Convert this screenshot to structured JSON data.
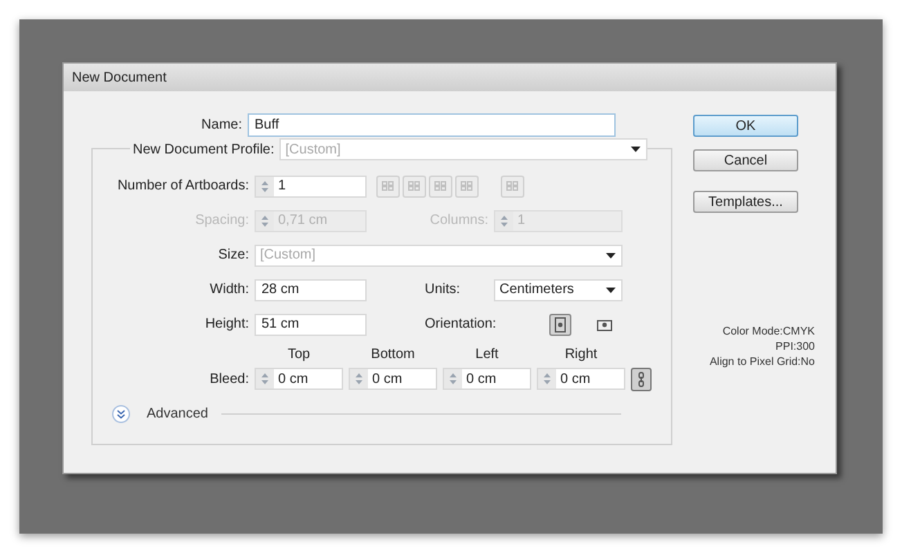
{
  "window": {
    "title": "New Document"
  },
  "name": {
    "label": "Name:",
    "value": "Buff"
  },
  "profile": {
    "label": "New Document Profile:",
    "placeholder": "[Custom]"
  },
  "artboards": {
    "label": "Number of Artboards:",
    "value": "1"
  },
  "spacing": {
    "label": "Spacing:",
    "value": "0,71 cm",
    "disabled": true
  },
  "columns": {
    "label": "Columns:",
    "value": "1",
    "disabled": true
  },
  "size": {
    "label": "Size:",
    "placeholder": "[Custom]"
  },
  "width": {
    "label": "Width:",
    "value": "28 cm"
  },
  "height": {
    "label": "Height:",
    "value": "51 cm"
  },
  "units": {
    "label": "Units:",
    "value": "Centimeters"
  },
  "orientation": {
    "label": "Orientation:",
    "options": [
      {
        "kind": "portrait",
        "selected": true
      },
      {
        "kind": "landscape",
        "selected": false
      }
    ]
  },
  "bleed": {
    "label": "Bleed:",
    "linked": true,
    "sides": [
      {
        "label": "Top",
        "value": "0 cm"
      },
      {
        "label": "Bottom",
        "value": "0 cm"
      },
      {
        "label": "Left",
        "value": "0 cm"
      },
      {
        "label": "Right",
        "value": "0 cm"
      }
    ]
  },
  "advanced": {
    "label": "Advanced",
    "expanded": false
  },
  "buttons": [
    {
      "label": "OK",
      "default": true
    },
    {
      "label": "Cancel",
      "default": false
    },
    {
      "label": "Templates...",
      "default": false
    }
  ],
  "info": [
    "Color Mode:CMYK",
    "PPI:300",
    "Align to Pixel Grid:No"
  ]
}
